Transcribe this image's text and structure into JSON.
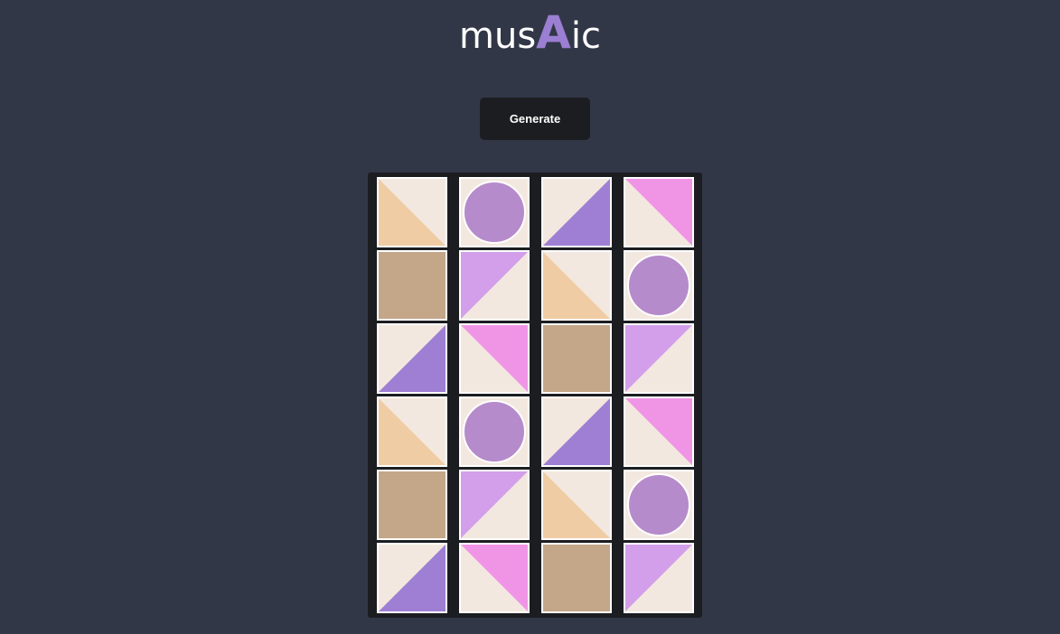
{
  "logo": {
    "prefix": "mus",
    "accent": "A",
    "suffix": "ic"
  },
  "toolbar": {
    "generate_label": "Generate"
  },
  "colors": {
    "background": "#323748",
    "board": "#1c1d21",
    "tile_base": "#f3e8df",
    "peach": "#f0ccA5",
    "lavender": "#d39fea",
    "purple": "#9e7fd4",
    "pink": "#f095e6",
    "tan": "#c4a689",
    "circle": "#b68bcb"
  },
  "grid": {
    "rows": 6,
    "cols": 4,
    "tiles": [
      [
        {
          "shape": "tri-bl",
          "color": "peach"
        },
        {
          "shape": "circle",
          "color": "circle"
        },
        {
          "shape": "tri-br",
          "color": "purple"
        },
        {
          "shape": "tri-tr",
          "color": "pink"
        }
      ],
      [
        {
          "shape": "square",
          "color": "tan"
        },
        {
          "shape": "tri-tl",
          "color": "lavender"
        },
        {
          "shape": "tri-bl",
          "color": "peach"
        },
        {
          "shape": "circle",
          "color": "circle"
        }
      ],
      [
        {
          "shape": "tri-br",
          "color": "purple"
        },
        {
          "shape": "tri-tr",
          "color": "pink"
        },
        {
          "shape": "square",
          "color": "tan"
        },
        {
          "shape": "tri-tl",
          "color": "lavender"
        }
      ],
      [
        {
          "shape": "tri-bl",
          "color": "peach"
        },
        {
          "shape": "circle",
          "color": "circle"
        },
        {
          "shape": "tri-br",
          "color": "purple"
        },
        {
          "shape": "tri-tr",
          "color": "pink"
        }
      ],
      [
        {
          "shape": "square",
          "color": "tan"
        },
        {
          "shape": "tri-tl",
          "color": "lavender"
        },
        {
          "shape": "tri-bl",
          "color": "peach"
        },
        {
          "shape": "circle",
          "color": "circle"
        }
      ],
      [
        {
          "shape": "tri-br",
          "color": "purple"
        },
        {
          "shape": "tri-tr",
          "color": "pink"
        },
        {
          "shape": "square",
          "color": "tan"
        },
        {
          "shape": "tri-tl",
          "color": "lavender"
        }
      ]
    ]
  }
}
